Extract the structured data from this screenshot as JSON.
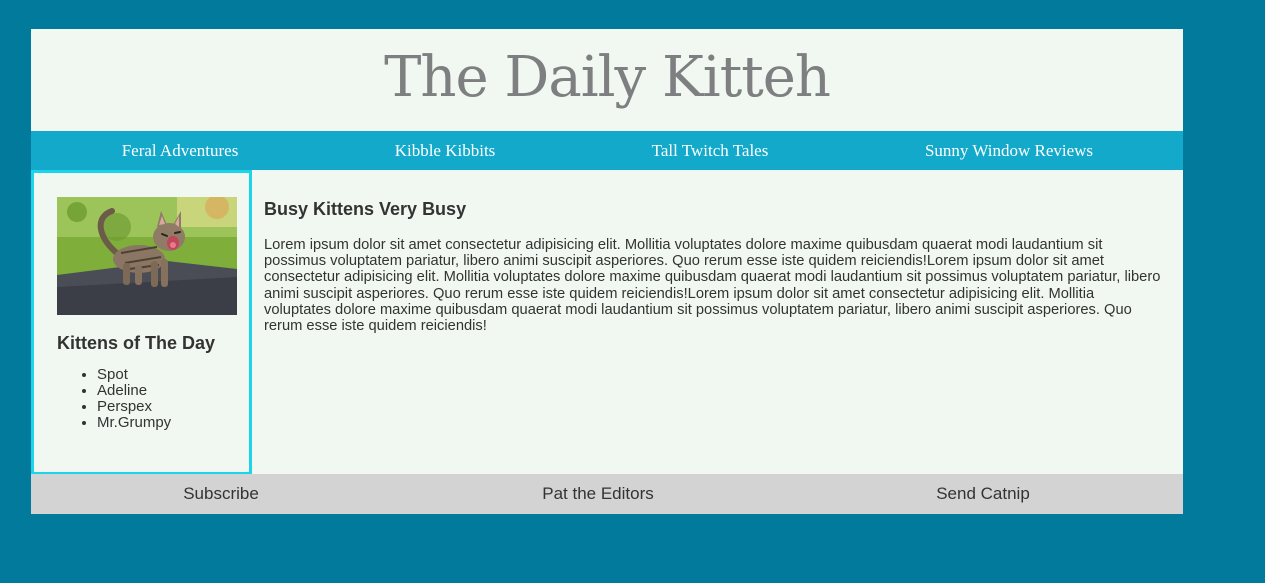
{
  "masthead": {
    "title": "The Daily Kitteh"
  },
  "nav": {
    "items": [
      {
        "label": "Feral Adventures"
      },
      {
        "label": "Kibble Kibbits"
      },
      {
        "label": "Tall Twitch Tales"
      },
      {
        "label": "Sunny Window Reviews"
      }
    ]
  },
  "sidebar": {
    "heading": "Kittens of The Day",
    "kittens": [
      "Spot",
      "Adeline",
      "Perspex",
      "Mr.Grumpy"
    ]
  },
  "article": {
    "heading": "Busy Kittens Very Busy",
    "body": "Lorem ipsum dolor sit amet consectetur adipisicing elit. Mollitia voluptates dolore maxime quibusdam quaerat modi laudantium sit possimus voluptatem pariatur, libero animi suscipit asperiores. Quo rerum esse iste quidem reiciendis!Lorem ipsum dolor sit amet consectetur adipisicing elit. Mollitia voluptates dolore maxime quibusdam quaerat modi laudantium sit possimus voluptatem pariatur, libero animi suscipit asperiores. Quo rerum esse iste quidem reiciendis!Lorem ipsum dolor sit amet consectetur adipisicing elit. Mollitia voluptates dolore maxime quibusdam quaerat modi laudantium sit possimus voluptatem pariatur, libero animi suscipit asperiores. Quo rerum esse iste quidem reiciendis!"
  },
  "footer": {
    "links": [
      {
        "label": "Subscribe"
      },
      {
        "label": "Pat the Editors"
      },
      {
        "label": "Send Catnip"
      }
    ]
  },
  "colors": {
    "background": "#017a9b",
    "page": "#f1f8f1",
    "nav": "#12a9cb",
    "sidebar_border": "#1cd5ea",
    "footer": "#d3d3d3",
    "title": "#7e7f80"
  }
}
